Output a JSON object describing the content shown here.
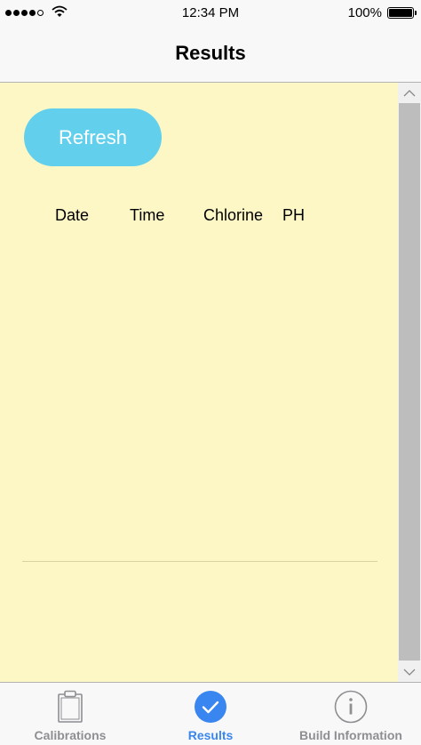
{
  "status_bar": {
    "time": "12:34 PM",
    "battery": "100%"
  },
  "nav": {
    "title": "Results"
  },
  "content": {
    "refresh_label": "Refresh",
    "columns": [
      "Date",
      "Time",
      "Chlorine",
      "PH"
    ],
    "background_color": "#fdf7c6",
    "button_color": "#62d0ec"
  },
  "tabs": [
    {
      "label": "Calibrations",
      "icon": "clipboard-icon",
      "active": false
    },
    {
      "label": "Results",
      "icon": "checkmark-circle-icon",
      "active": true
    },
    {
      "label": "Build Information",
      "icon": "info-circle-icon",
      "active": false
    }
  ],
  "colors": {
    "accent": "#3a86f0",
    "inactive": "#8e8e93"
  }
}
